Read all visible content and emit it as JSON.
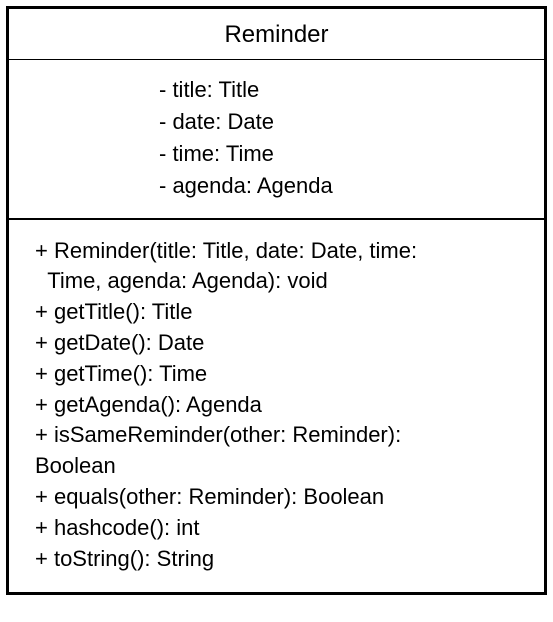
{
  "class": {
    "name": "Reminder",
    "attributes": [
      "- title: Title",
      "- date: Date",
      "- time: Time",
      "- agenda: Agenda"
    ],
    "methods": [
      "+ Reminder(title: Title, date: Date, time:\n  Time, agenda: Agenda): void",
      "+ getTitle(): Title",
      "+ getDate(): Date",
      "+ getTime(): Time",
      "+ getAgenda(): Agenda",
      "+ isSameReminder(other: Reminder):\nBoolean",
      "+ equals(other: Reminder): Boolean",
      "+ hashcode(): int",
      "+ toString(): String"
    ]
  }
}
